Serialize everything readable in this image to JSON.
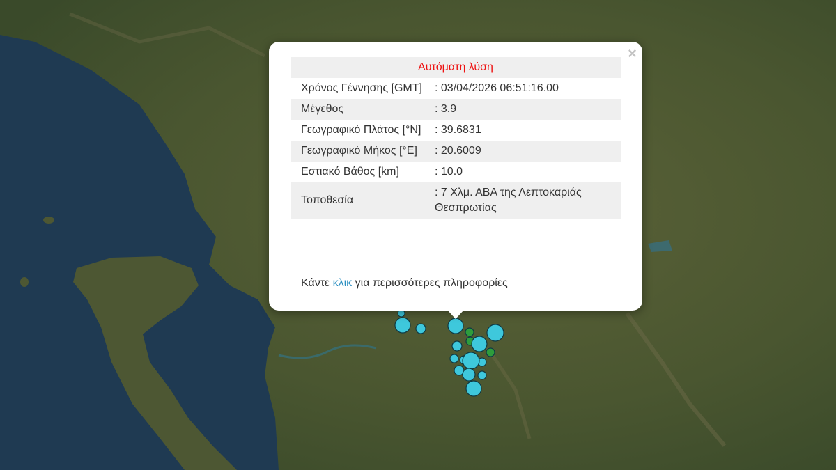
{
  "popup": {
    "header": "Αυτόματη λύση",
    "close_label": "×",
    "rows": [
      {
        "label": "Χρόνος Γέννησης [GMT]",
        "value": ": 03/04/2026 06:51:16.00"
      },
      {
        "label": "Μέγεθος",
        "value": ": 3.9"
      },
      {
        "label": "Γεωγραφικό Πλάτος [°N]",
        "value": ": 39.6831"
      },
      {
        "label": "Γεωγραφικό Μήκος [°E]",
        "value": ": 20.6009"
      },
      {
        "label": "Εστιακό Βάθος [km]",
        "value": ": 10.0"
      },
      {
        "label": "Τοποθεσία",
        "value": ": 7 Χλμ. ΑΒΑ της Λεπτοκαριάς Θεσπρωτίας"
      }
    ],
    "more_prefix": "Κάντε ",
    "more_link": "κλικ",
    "more_suffix": " για περισσότερες πληροφορίες"
  },
  "map": {
    "colors": {
      "sea": "#1f3a52",
      "land": "#48552f",
      "marker_cyan": "#3ec8dc",
      "marker_green": "#2e9c3c",
      "marker_stroke": "#0e3a44"
    }
  }
}
